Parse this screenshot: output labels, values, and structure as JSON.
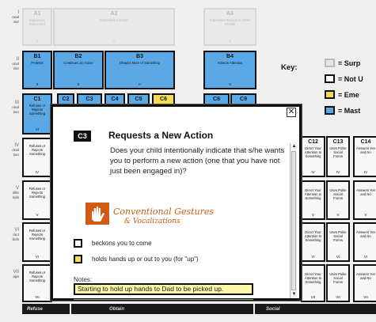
{
  "rows": [
    {
      "label": "onal\nvior",
      "roman": "I"
    },
    {
      "label": "onal\nvior",
      "roman": "II"
    },
    {
      "label": "onal\ntion",
      "roman": "III"
    },
    {
      "label": "onal\ntion",
      "roman": "IV"
    },
    {
      "label": "olite\nsals",
      "roman": "V"
    },
    {
      "label": "ract\nbols",
      "roman": "VI"
    },
    {
      "label": "age",
      "roman": "VII"
    }
  ],
  "cells_top": {
    "a1": {
      "code": "A1",
      "text": "Expresses Discomfort",
      "level": "I"
    },
    "a2": {
      "code": "A2",
      "text": "Expresses Comfort",
      "level": "I"
    },
    "a3": {
      "code": "A3",
      "text": "Expresses Interest in Other People",
      "level": "I"
    },
    "b1": {
      "code": "B1",
      "text": "Protests",
      "level": "II"
    },
    "b2": {
      "code": "B2",
      "text": "Continues an Action",
      "level": "II"
    },
    "b3": {
      "code": "B3",
      "text": "Obtains More of Something",
      "level": "II"
    },
    "b4": {
      "code": "B4",
      "text": "Attracts Attention",
      "level": "II"
    },
    "c1": {
      "code": "C1",
      "text": "Refuses or Rejects Something",
      "level": "III"
    },
    "c2": {
      "code": "C2"
    },
    "c3": {
      "code": "C3"
    },
    "c4": {
      "code": "C4"
    },
    "c5": {
      "code": "C5"
    },
    "c6": {
      "code": "C6"
    },
    "c8": {
      "code": "C8"
    },
    "c9": {
      "code": "C9"
    }
  },
  "left_col": [
    {
      "text": "Refuses or Rejects Something",
      "level": "IV"
    },
    {
      "text": "Refuses or Rejects Something",
      "level": "V"
    },
    {
      "text": "Refuses or Rejects Something",
      "level": "VI"
    },
    {
      "text": "Refuses or Rejects Something",
      "level": "VII"
    }
  ],
  "right_cols": {
    "c12": {
      "code": "C12",
      "text": "Direct Your Attention to Something"
    },
    "c13": {
      "code": "C13",
      "text": "Uses Polite Social Forms"
    },
    "c14": {
      "code": "C14",
      "text": "Answers Yes and No"
    },
    "levels": [
      "IV",
      "V",
      "VI",
      "VII"
    ]
  },
  "bottom_bar": {
    "refuse": "Refuse",
    "obtain": "Obtain",
    "social": "Social"
  },
  "key": {
    "title": "Key:",
    "items": [
      {
        "label": "= Surp",
        "color": "#e6e6e6"
      },
      {
        "label": "= Not U",
        "color": "#ffffff"
      },
      {
        "label": "= Eme",
        "color": "#f2dc55"
      },
      {
        "label": "= Mast",
        "color": "#5aa9e6"
      }
    ]
  },
  "modal": {
    "close": "✕",
    "badge": "C3",
    "title": "Requests a New Action",
    "question": "Does your child  intentionally  indicate that s/he wants you to perform a new action (one that you have not just been engaged in)?",
    "category_line1": "Conventional Gestures",
    "category_line2": "& Vocalizations",
    "options": [
      {
        "label": "beckons you to come",
        "state": "not-used"
      },
      {
        "label": "holds hands up or out to you (for \"up\")",
        "state": "emerging"
      }
    ],
    "notes_label": "Notes:",
    "notes_value": "Starting to hold up hands to Dad to be picked up."
  }
}
